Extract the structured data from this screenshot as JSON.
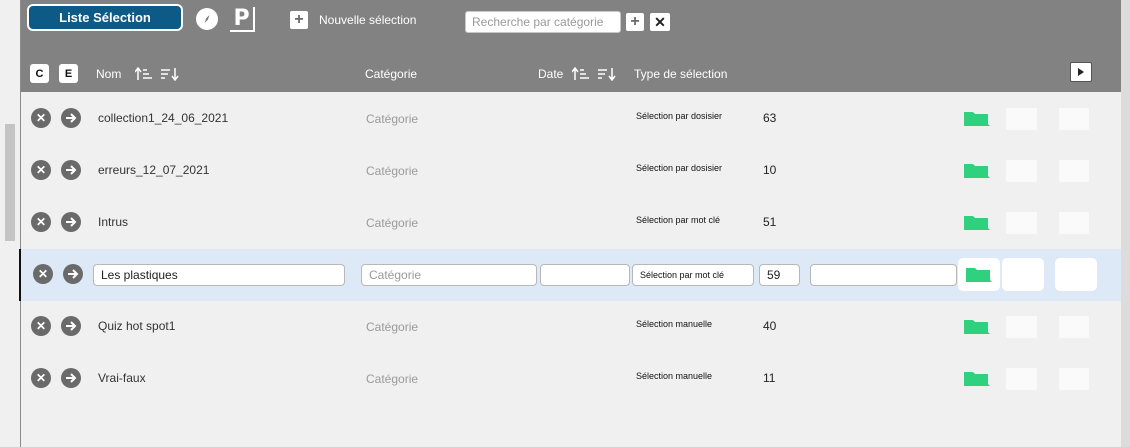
{
  "toolbar": {
    "list_button_label": "Liste Sélection",
    "p_button_label": "P",
    "new_selection_label": "Nouvelle sélection",
    "search_placeholder": "Recherche par catégorie",
    "plus_glyph": "+",
    "clear_glyph": "✕"
  },
  "columns": {
    "c_button": "C",
    "e_button": "E",
    "name": "Nom",
    "category": "Catégorie",
    "date": "Date",
    "selection_type": "Type de sélection"
  },
  "rows": [
    {
      "name": "collection1_24_06_2021",
      "category": "Catégorie",
      "type": "Sélection par dosisier",
      "count": "63"
    },
    {
      "name": "erreurs_12_07_2021",
      "category": "Catégorie",
      "type": "Sélection par dosisier",
      "count": "10"
    },
    {
      "name": "Intrus",
      "category": "Catégorie",
      "type": "Sélection par mot clé",
      "count": "51"
    },
    {
      "name": "Les plastiques",
      "category": "",
      "category_placeholder": "Catégorie",
      "date": "",
      "type": "Sélection par mot clé",
      "count": "59",
      "extra": ""
    },
    {
      "name": "Quiz hot spot1",
      "category": "Catégorie",
      "type": "Sélection manuelle",
      "count": "40"
    },
    {
      "name": "Vrai-faux",
      "category": "Catégorie",
      "type": "Sélection manuelle",
      "count": "11"
    }
  ],
  "icons": {
    "remove": "close-circle-icon",
    "open": "arrow-right-circle-icon",
    "folder": "folder-icon",
    "compass": "compass-icon",
    "sort": "sort-icon",
    "panel_toggle": "play-box-icon"
  },
  "colors": {
    "header_bg": "#828282",
    "primary_button": "#0e5a86",
    "folder_green": "#2fd17f",
    "selected_row": "#dde9f6"
  }
}
